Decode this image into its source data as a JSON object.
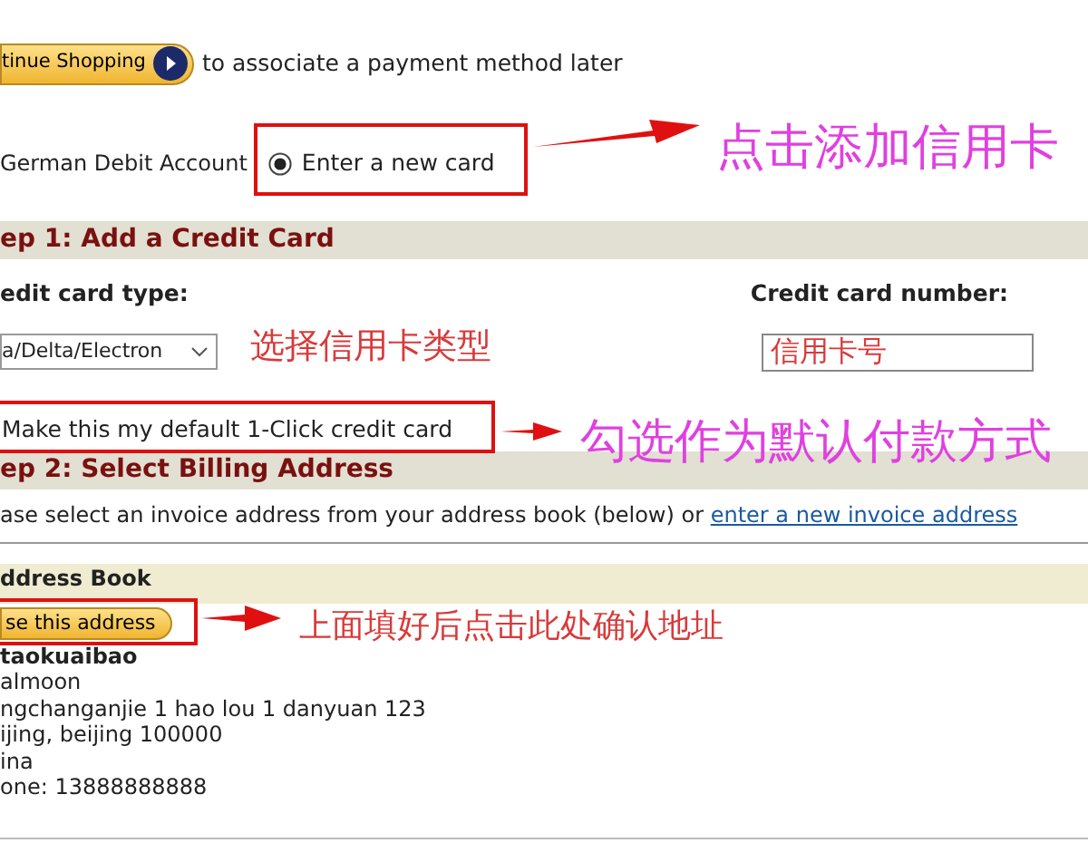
{
  "continue_row": {
    "button": "tinue Shopping",
    "text": "to associate a payment method later"
  },
  "payment_row": {
    "other_option": "German Debit Account",
    "new_card": {
      "label": "Enter a new card",
      "selected": true
    }
  },
  "step1": {
    "heading": "ep 1: Add a Credit Card",
    "card_type_label": "edit card type:",
    "card_number_label": "Credit card number:",
    "card_type": "a/Delta/Electron",
    "card_number": "信用卡号",
    "default_card": "Make this my default 1-Click credit card"
  },
  "step2": {
    "heading": "ep 2: Select Billing Address",
    "instruction": "ase select an invoice address from your address book (below) or",
    "link": "enter a new invoice address"
  },
  "address_book": {
    "heading": "ddress Book",
    "button": "se this address",
    "name": "taokuaibao",
    "lines": [
      "almoon",
      "ngchanganjie 1 hao lou 1 danyuan 123",
      "ijing, beijing 100000",
      "ina",
      "one: 13888888888"
    ]
  },
  "annotations": [
    {
      "text": "点击添加信用卡",
      "color": "#e040e0"
    },
    {
      "text": "选择信用卡类型",
      "color": "#d83a3a"
    },
    {
      "text": "勾选作为默认付款方式",
      "color": "#e040e0"
    },
    {
      "text": "上面填好后点击此处确认地址",
      "color": "#d83a3a"
    }
  ]
}
